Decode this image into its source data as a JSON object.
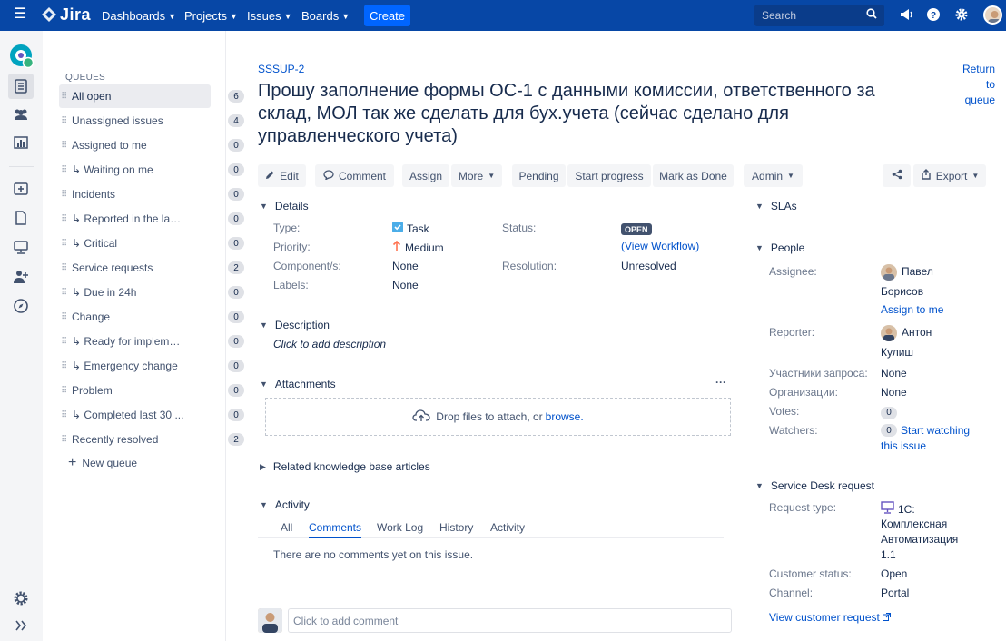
{
  "topbar": {
    "logo": "Jira",
    "nav": [
      "Dashboards",
      "Projects",
      "Issues",
      "Boards"
    ],
    "create": "Create",
    "search_placeholder": "Search"
  },
  "queues": {
    "heading": "QUEUES",
    "items": [
      {
        "label": "All open",
        "count": "6"
      },
      {
        "label": "Unassigned issues",
        "count": "4"
      },
      {
        "label": "Assigned to me",
        "count": "0"
      },
      {
        "label": "↳ Waiting on me",
        "count": "0"
      },
      {
        "label": "Incidents",
        "count": "0"
      },
      {
        "label": "↳ Reported in the last...",
        "count": "0"
      },
      {
        "label": "↳ Critical",
        "count": "0"
      },
      {
        "label": "Service requests",
        "count": "2"
      },
      {
        "label": "↳ Due in 24h",
        "count": "0"
      },
      {
        "label": "Change",
        "count": "0"
      },
      {
        "label": "↳ Ready for impleme...",
        "count": "0"
      },
      {
        "label": "↳ Emergency change",
        "count": "0"
      },
      {
        "label": "Problem",
        "count": "0"
      },
      {
        "label": "↳ Completed last 30 ...",
        "count": "0"
      },
      {
        "label": "Recently resolved",
        "count": "2"
      }
    ],
    "new_queue": "New queue"
  },
  "issue": {
    "key": "SSSUP-2",
    "return_to_queue": "Return to queue",
    "title": "Прошу заполнение формы ОС-1 с данными комиссии, ответственного за склад, МОЛ так же сделать для бух.учета (сейчас сделано для управленческого учета)"
  },
  "toolbar": {
    "edit": "Edit",
    "comment": "Comment",
    "assign": "Assign",
    "more": "More",
    "pending": "Pending",
    "start_progress": "Start progress",
    "mark_done": "Mark as Done",
    "admin": "Admin",
    "export": "Export"
  },
  "details": {
    "heading": "Details",
    "type_label": "Type:",
    "type_value": "Task",
    "priority_label": "Priority:",
    "priority_value": "Medium",
    "component_label": "Component/s:",
    "component_value": "None",
    "labels_label": "Labels:",
    "labels_value": "None",
    "status_label": "Status:",
    "status_value": "OPEN",
    "view_workflow": "(View Workflow)",
    "resolution_label": "Resolution:",
    "resolution_value": "Unresolved"
  },
  "description": {
    "heading": "Description",
    "placeholder": "Click to add description"
  },
  "attachments": {
    "heading": "Attachments",
    "drop_text": "Drop files to attach, or",
    "browse": "browse."
  },
  "knowledge": {
    "heading": "Related knowledge base articles"
  },
  "activity": {
    "heading": "Activity",
    "tabs": [
      "All",
      "Comments",
      "Work Log",
      "History",
      "Activity"
    ],
    "active_tab": "Comments",
    "empty": "There are no comments yet on this issue.",
    "comment_placeholder": "Click to add comment"
  },
  "slas": {
    "heading": "SLAs"
  },
  "people": {
    "heading": "People",
    "assignee_label": "Assignee:",
    "assignee_first": "Павел",
    "assignee_last": "Борисов",
    "assign_to_me": "Assign to me",
    "reporter_label": "Reporter:",
    "reporter_first": "Антон",
    "reporter_last": "Кулиш",
    "participants_label": "Участники запроса:",
    "participants_value": "None",
    "orgs_label": "Организации:",
    "orgs_value": "None",
    "votes_label": "Votes:",
    "votes_value": "0",
    "watchers_label": "Watchers:",
    "watchers_value": "0",
    "start_watching_1": "Start watching",
    "start_watching_2": "this issue"
  },
  "service_desk": {
    "heading": "Service Desk request",
    "request_type_label": "Request type:",
    "request_type_1": "1С:",
    "request_type_2": "Комплексная",
    "request_type_3": "Автоматизация",
    "request_type_4": "1.1",
    "customer_status_label": "Customer status:",
    "customer_status_value": "Open",
    "channel_label": "Channel:",
    "channel_value": "Portal",
    "view_customer_request": "View customer request"
  },
  "colors": {
    "topbar": "#0747a6",
    "create": "#0065ff",
    "link": "#0052cc",
    "lozenge": "#42526e",
    "priority": "#ff7452",
    "task": "#4bade8"
  }
}
